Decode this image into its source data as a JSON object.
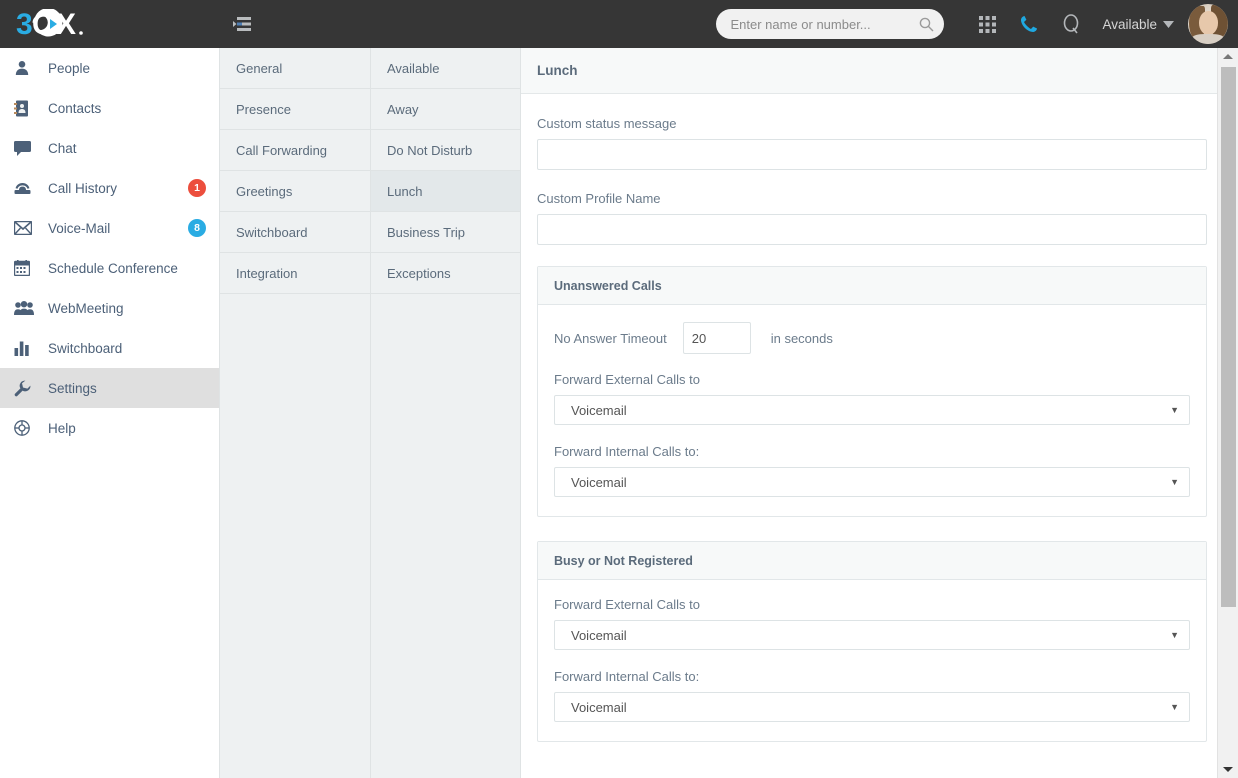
{
  "app": {
    "logo_text": "3CX",
    "collapse_icon": "collapse-list-icon"
  },
  "topbar": {
    "search_placeholder": "Enter name or number...",
    "search_value": "",
    "search_icon": "search-icon",
    "apps_icon": "grid-apps-icon",
    "dial_icon": "phone-icon",
    "queue_icon": "queue-q-icon",
    "status_label": "Available",
    "status_caret_icon": "chevron-down-icon",
    "avatar_name": "user-avatar"
  },
  "sidebar": {
    "items": [
      {
        "label": "People",
        "icon": "person-icon",
        "badge": null,
        "badge_color": null,
        "active": false
      },
      {
        "label": "Contacts",
        "icon": "address-book-icon",
        "badge": null,
        "badge_color": null,
        "active": false
      },
      {
        "label": "Chat",
        "icon": "chat-bubble-icon",
        "badge": null,
        "badge_color": null,
        "active": false
      },
      {
        "label": "Call History",
        "icon": "telephone-icon",
        "badge": "1",
        "badge_color": "#ec4e3d",
        "active": false
      },
      {
        "label": "Voice-Mail",
        "icon": "envelope-icon",
        "badge": "8",
        "badge_color": "#2aace3",
        "active": false
      },
      {
        "label": "Schedule Conference",
        "icon": "calendar-icon",
        "badge": null,
        "badge_color": null,
        "active": false
      },
      {
        "label": "WebMeeting",
        "icon": "group-people-icon",
        "badge": null,
        "badge_color": null,
        "active": false
      },
      {
        "label": "Switchboard",
        "icon": "bar-chart-icon",
        "badge": null,
        "badge_color": null,
        "active": false
      },
      {
        "label": "Settings",
        "icon": "wrench-icon",
        "badge": null,
        "badge_color": null,
        "active": true
      },
      {
        "label": "Help",
        "icon": "lifebuoy-icon",
        "badge": null,
        "badge_color": null,
        "active": false
      }
    ]
  },
  "categories": {
    "items": [
      {
        "label": "General",
        "active": false
      },
      {
        "label": "Presence",
        "active": false
      },
      {
        "label": "Call Forwarding",
        "active": false
      },
      {
        "label": "Greetings",
        "active": false
      },
      {
        "label": "Switchboard",
        "active": false
      },
      {
        "label": "Integration",
        "active": false
      }
    ]
  },
  "profiles": {
    "items": [
      {
        "label": "Available",
        "active": false
      },
      {
        "label": "Away",
        "active": false
      },
      {
        "label": "Do Not Disturb",
        "active": false
      },
      {
        "label": "Lunch",
        "active": true
      },
      {
        "label": "Business Trip",
        "active": false
      },
      {
        "label": "Exceptions",
        "active": false
      }
    ]
  },
  "main": {
    "title": "Lunch",
    "custom_status_message_label": "Custom status message",
    "custom_status_message_value": "",
    "custom_profile_name_label": "Custom Profile Name",
    "custom_profile_name_value": "",
    "unanswered": {
      "title": "Unanswered Calls",
      "timeout_label": "No Answer Timeout",
      "timeout_value": "20",
      "timeout_suffix": "in seconds",
      "external_label": "Forward External Calls to",
      "external_value": "Voicemail",
      "internal_label": "Forward Internal Calls to:",
      "internal_value": "Voicemail"
    },
    "busy": {
      "title": "Busy or Not Registered",
      "external_label": "Forward External Calls to",
      "external_value": "Voicemail",
      "internal_label": "Forward Internal Calls to:",
      "internal_value": "Voicemail"
    }
  },
  "scrollbar": {
    "up_icon": "scroll-up-arrow-icon",
    "down_icon": "scroll-down-arrow-icon"
  },
  "colors": {
    "topbar_bg": "#363636",
    "accent_blue": "#2aace3",
    "badge_red": "#ec4e3d",
    "nav_text": "#4c6078",
    "panel_bg": "#eef1f2"
  }
}
